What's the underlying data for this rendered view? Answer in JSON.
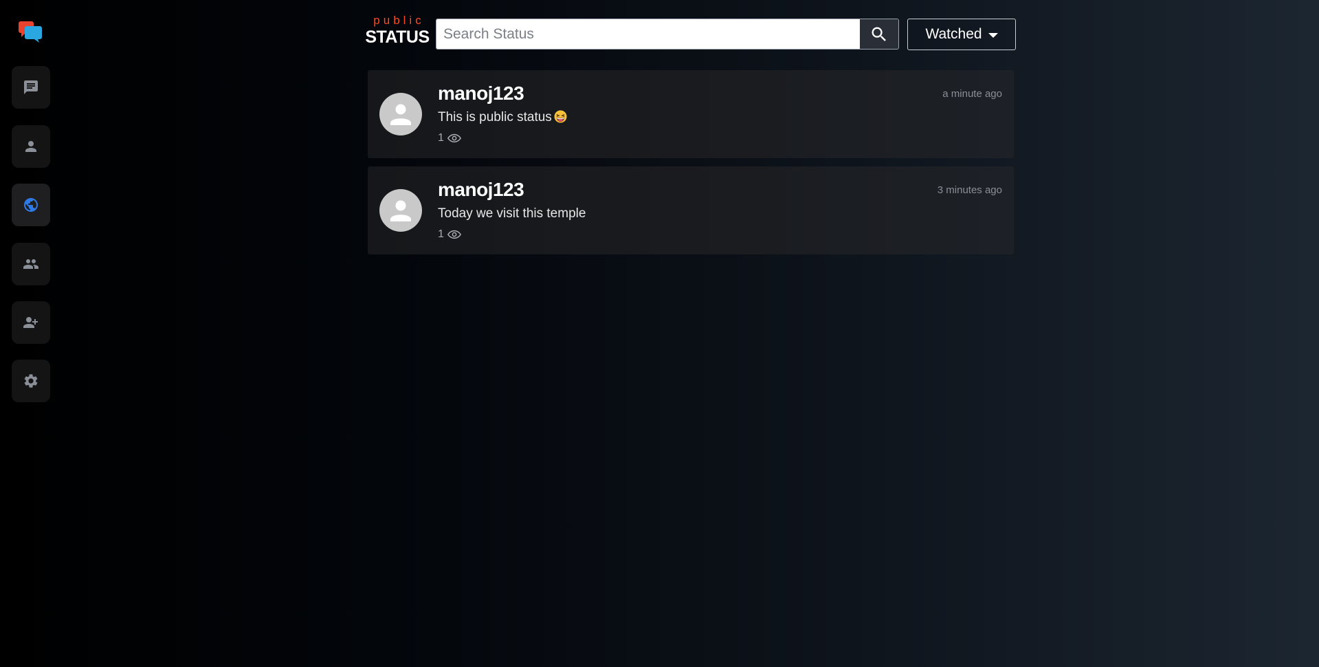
{
  "sidebar": {
    "logo_icon": "chat-bubbles-logo-icon",
    "items": [
      {
        "name": "messages",
        "icon": "message-icon",
        "active": false
      },
      {
        "name": "profile",
        "icon": "person-icon",
        "active": false
      },
      {
        "name": "public-status",
        "icon": "globe-icon",
        "active": true
      },
      {
        "name": "friends",
        "icon": "group-icon",
        "active": false
      },
      {
        "name": "add-friend",
        "icon": "person-add-icon",
        "active": false
      },
      {
        "name": "settings",
        "icon": "gear-icon",
        "active": false
      }
    ],
    "active_color": "#2f7be6"
  },
  "header": {
    "brand_top": "public",
    "brand_bottom": "STATUS",
    "brand_top_color": "#ff4b1f",
    "search_placeholder": "Search Status",
    "search_value": "",
    "filter_selected": "Watched"
  },
  "statuses": [
    {
      "username": "manoj123",
      "text": "This is public status",
      "emoji": "grinning-squinting-face",
      "views": "1",
      "time": "a minute ago"
    },
    {
      "username": "manoj123",
      "text": "Today we visit this temple",
      "views": "1",
      "time": "3 minutes ago"
    }
  ]
}
